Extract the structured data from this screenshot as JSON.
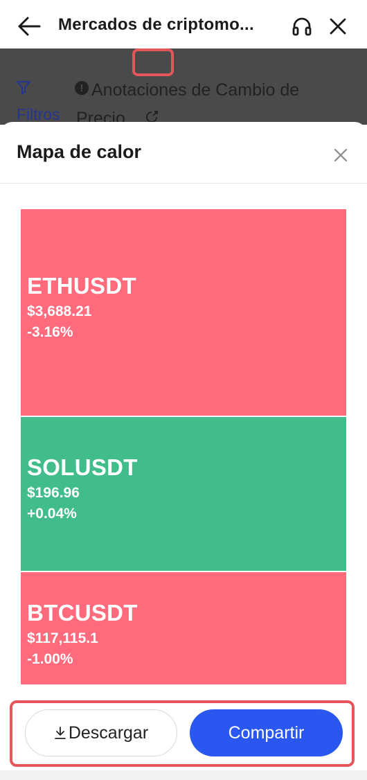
{
  "header": {
    "title": "Mercados de criptomo...",
    "icons": [
      "back-arrow-icon",
      "headset-icon",
      "close-icon"
    ]
  },
  "background_page": {
    "filters_label": "Filtros",
    "annotation_text": "Anotaciones de Cambio de Precio",
    "info_icon_glyph": "!"
  },
  "sheet": {
    "title": "Mapa de calor"
  },
  "heatmap": {
    "tiles": [
      {
        "symbol": "ETHUSDT",
        "price": "$3,688.21",
        "change": "-3.16%",
        "color": "#ff6b7c"
      },
      {
        "symbol": "SOLUSDT",
        "price": "$196.96",
        "change": "+0.04%",
        "color": "#40bd8a"
      },
      {
        "symbol": "BTCUSDT",
        "price": "$117,115.1",
        "change": "-1.00%",
        "color": "#ff6b7c"
      }
    ]
  },
  "footer": {
    "download_label": "Descargar",
    "share_label": "Compartir"
  },
  "colors": {
    "accent_blue": "#2957f0",
    "highlight_red": "#e5565a",
    "negative": "#ff6b7c",
    "positive": "#40bd8a"
  }
}
